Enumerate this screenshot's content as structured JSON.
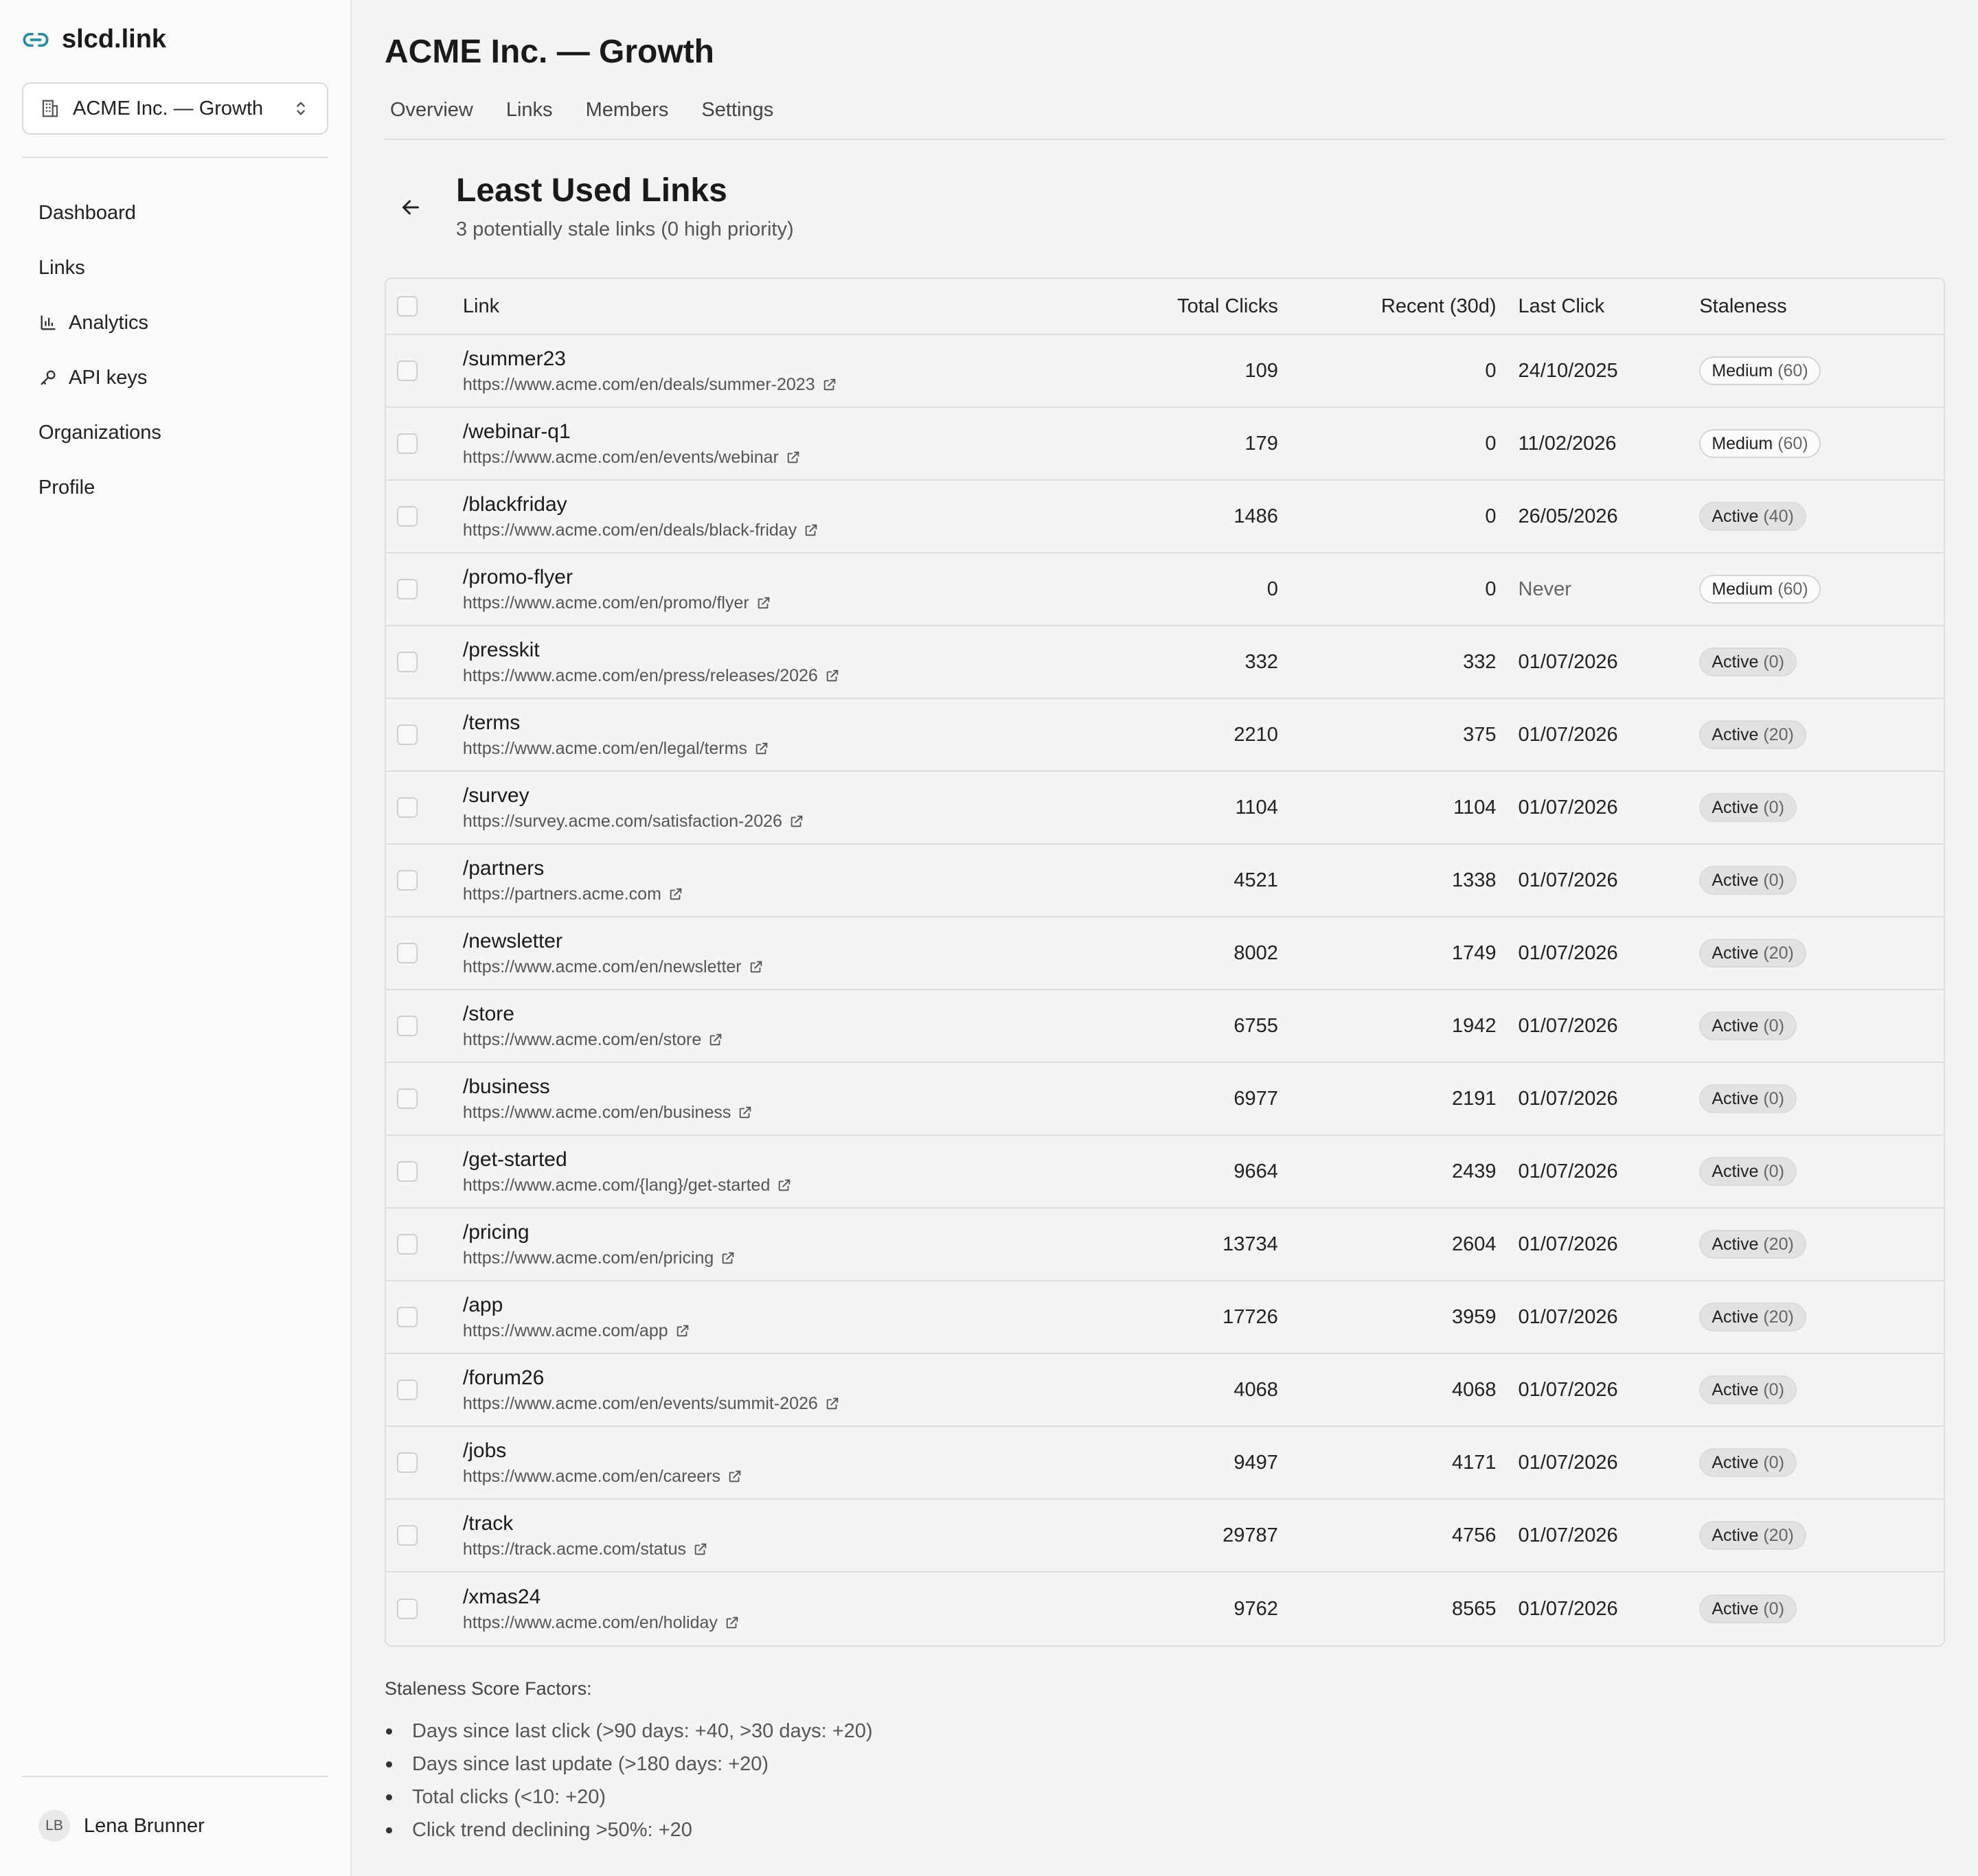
{
  "app": {
    "brand": "slcd.link"
  },
  "org_switcher": {
    "label": "ACME Inc. — Growth"
  },
  "sidebar": {
    "items": [
      {
        "label": "Dashboard",
        "icon": ""
      },
      {
        "label": "Links",
        "icon": ""
      },
      {
        "label": "Analytics",
        "icon": "bar-chart-icon"
      },
      {
        "label": "API keys",
        "icon": "key-icon"
      },
      {
        "label": "Organizations",
        "icon": ""
      },
      {
        "label": "Profile",
        "icon": ""
      }
    ],
    "user": {
      "initials": "LB",
      "name": "Lena Brunner"
    }
  },
  "header": {
    "title": "ACME Inc. — Growth",
    "tabs": [
      "Overview",
      "Links",
      "Members",
      "Settings"
    ]
  },
  "section": {
    "title": "Least Used Links",
    "subtitle": "3 potentially stale links (0 high priority)"
  },
  "table": {
    "columns": [
      "Link",
      "Total Clicks",
      "Recent (30d)",
      "Last Click",
      "Staleness"
    ],
    "rows": [
      {
        "slug": "/summer23",
        "url": "https://www.acme.com/en/deals/summer-2023",
        "total": "109",
        "recent": "0",
        "last": "24/10/2025",
        "status": "Medium",
        "score": "(60)",
        "kind": "medium"
      },
      {
        "slug": "/webinar-q1",
        "url": "https://www.acme.com/en/events/webinar",
        "total": "179",
        "recent": "0",
        "last": "11/02/2026",
        "status": "Medium",
        "score": "(60)",
        "kind": "medium"
      },
      {
        "slug": "/blackfriday",
        "url": "https://www.acme.com/en/deals/black-friday",
        "total": "1486",
        "recent": "0",
        "last": "26/05/2026",
        "status": "Active",
        "score": "(40)",
        "kind": "active"
      },
      {
        "slug": "/promo-flyer",
        "url": "https://www.acme.com/en/promo/flyer",
        "total": "0",
        "recent": "0",
        "last": "Never",
        "status": "Medium",
        "score": "(60)",
        "kind": "medium"
      },
      {
        "slug": "/presskit",
        "url": "https://www.acme.com/en/press/releases/2026",
        "total": "332",
        "recent": "332",
        "last": "01/07/2026",
        "status": "Active",
        "score": "(0)",
        "kind": "active"
      },
      {
        "slug": "/terms",
        "url": "https://www.acme.com/en/legal/terms",
        "total": "2210",
        "recent": "375",
        "last": "01/07/2026",
        "status": "Active",
        "score": "(20)",
        "kind": "active"
      },
      {
        "slug": "/survey",
        "url": "https://survey.acme.com/satisfaction-2026",
        "total": "1104",
        "recent": "1104",
        "last": "01/07/2026",
        "status": "Active",
        "score": "(0)",
        "kind": "active"
      },
      {
        "slug": "/partners",
        "url": "https://partners.acme.com",
        "total": "4521",
        "recent": "1338",
        "last": "01/07/2026",
        "status": "Active",
        "score": "(0)",
        "kind": "active"
      },
      {
        "slug": "/newsletter",
        "url": "https://www.acme.com/en/newsletter",
        "total": "8002",
        "recent": "1749",
        "last": "01/07/2026",
        "status": "Active",
        "score": "(20)",
        "kind": "active"
      },
      {
        "slug": "/store",
        "url": "https://www.acme.com/en/store",
        "total": "6755",
        "recent": "1942",
        "last": "01/07/2026",
        "status": "Active",
        "score": "(0)",
        "kind": "active"
      },
      {
        "slug": "/business",
        "url": "https://www.acme.com/en/business",
        "total": "6977",
        "recent": "2191",
        "last": "01/07/2026",
        "status": "Active",
        "score": "(0)",
        "kind": "active"
      },
      {
        "slug": "/get-started",
        "url": "https://www.acme.com/{lang}/get-started",
        "total": "9664",
        "recent": "2439",
        "last": "01/07/2026",
        "status": "Active",
        "score": "(0)",
        "kind": "active"
      },
      {
        "slug": "/pricing",
        "url": "https://www.acme.com/en/pricing",
        "total": "13734",
        "recent": "2604",
        "last": "01/07/2026",
        "status": "Active",
        "score": "(20)",
        "kind": "active"
      },
      {
        "slug": "/app",
        "url": "https://www.acme.com/app",
        "total": "17726",
        "recent": "3959",
        "last": "01/07/2026",
        "status": "Active",
        "score": "(20)",
        "kind": "active"
      },
      {
        "slug": "/forum26",
        "url": "https://www.acme.com/en/events/summit-2026",
        "total": "4068",
        "recent": "4068",
        "last": "01/07/2026",
        "status": "Active",
        "score": "(0)",
        "kind": "active"
      },
      {
        "slug": "/jobs",
        "url": "https://www.acme.com/en/careers",
        "total": "9497",
        "recent": "4171",
        "last": "01/07/2026",
        "status": "Active",
        "score": "(0)",
        "kind": "active"
      },
      {
        "slug": "/track",
        "url": "https://track.acme.com/status",
        "total": "29787",
        "recent": "4756",
        "last": "01/07/2026",
        "status": "Active",
        "score": "(20)",
        "kind": "active"
      },
      {
        "slug": "/xmas24",
        "url": "https://www.acme.com/en/holiday",
        "total": "9762",
        "recent": "8565",
        "last": "01/07/2026",
        "status": "Active",
        "score": "(0)",
        "kind": "active"
      }
    ]
  },
  "factors": {
    "title": "Staleness Score Factors:",
    "items": [
      "Days since last click (>90 days: +40, >30 days: +20)",
      "Days since last update (>180 days: +20)",
      "Total clicks (<10: +20)",
      "Click trend declining >50%: +20"
    ]
  },
  "colors": {
    "accent": "#2b8a9e",
    "background": "#f4f4f4",
    "sidebar": "#fafafa"
  }
}
